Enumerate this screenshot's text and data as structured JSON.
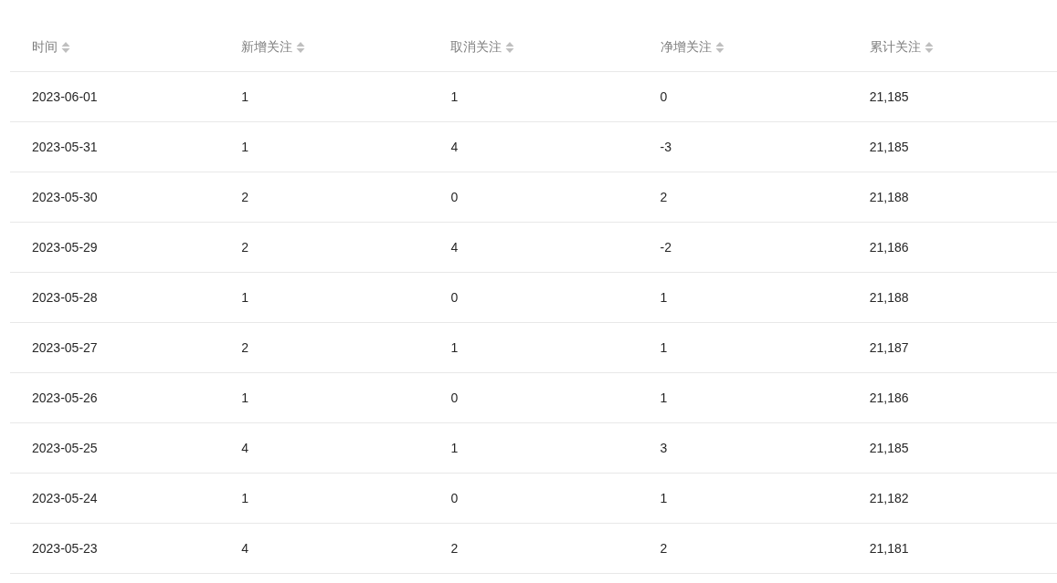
{
  "table": {
    "columns": [
      {
        "label": "时间",
        "sortable": true
      },
      {
        "label": "新增关注",
        "sortable": true
      },
      {
        "label": "取消关注",
        "sortable": true
      },
      {
        "label": "净增关注",
        "sortable": true
      },
      {
        "label": "累计关注",
        "sortable": true
      }
    ],
    "rows": [
      [
        "2023-06-01",
        "1",
        "1",
        "0",
        "21,185"
      ],
      [
        "2023-05-31",
        "1",
        "4",
        "-3",
        "21,185"
      ],
      [
        "2023-05-30",
        "2",
        "0",
        "2",
        "21,188"
      ],
      [
        "2023-05-29",
        "2",
        "4",
        "-2",
        "21,186"
      ],
      [
        "2023-05-28",
        "1",
        "0",
        "1",
        "21,188"
      ],
      [
        "2023-05-27",
        "2",
        "1",
        "1",
        "21,187"
      ],
      [
        "2023-05-26",
        "1",
        "0",
        "1",
        "21,186"
      ],
      [
        "2023-05-25",
        "4",
        "1",
        "3",
        "21,185"
      ],
      [
        "2023-05-24",
        "1",
        "0",
        "1",
        "21,182"
      ],
      [
        "2023-05-23",
        "4",
        "2",
        "2",
        "21,181"
      ]
    ]
  }
}
